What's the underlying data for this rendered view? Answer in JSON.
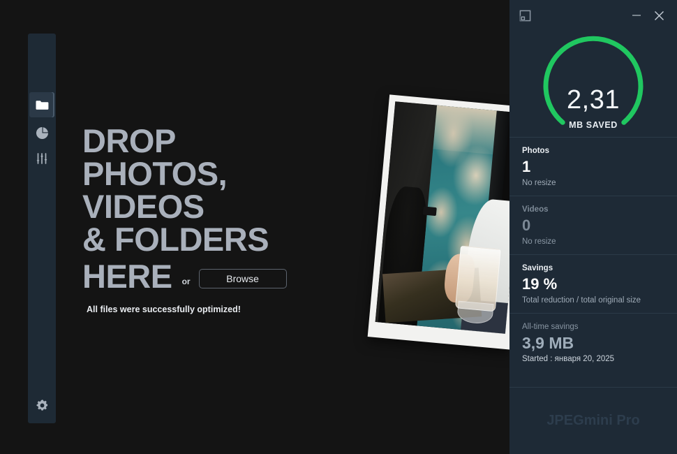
{
  "window": {
    "titlebar": {
      "expand_icon": "expand-panel-icon",
      "minimize_icon": "minimize-icon",
      "close_icon": "close-icon"
    }
  },
  "sidebar": {
    "items": [
      {
        "id": "folder",
        "icon": "folder-icon",
        "active": true
      },
      {
        "id": "stats",
        "icon": "pie-chart-icon",
        "active": false
      },
      {
        "id": "sliders",
        "icon": "sliders-icon",
        "active": false
      }
    ],
    "bottom": {
      "id": "settings",
      "icon": "gear-icon"
    }
  },
  "drop_area": {
    "headline_lines": "DROP\nPHOTOS,\nVIDEOS\n& FOLDERS",
    "headline_last_line": "HERE",
    "or_label": "or",
    "browse_label": "Browse",
    "status_message": "All files were successfully optimized!"
  },
  "photo": {
    "alt": "polaroid-photo-person-holding-glass-of-milk"
  },
  "stats": {
    "gauge": {
      "value": "2,31",
      "label": "MB SAVED",
      "color": "#20c760",
      "track_color": "#1e2a36",
      "percent": 100
    },
    "blocks": [
      {
        "id": "photos",
        "title": "Photos",
        "value": "1",
        "sub": "No resize",
        "dim": false
      },
      {
        "id": "videos",
        "title": "Videos",
        "value": "0",
        "sub": "No resize",
        "dim": true
      },
      {
        "id": "savings",
        "title": "Savings",
        "value": "19 %",
        "sub": "Total reduction / total original size",
        "dim": false
      },
      {
        "id": "all-time",
        "title": "All-time savings",
        "value": "3,9 MB",
        "sub": "Started : января 20, 2025",
        "dim": false
      }
    ],
    "brand": "JPEGmini Pro"
  },
  "colors": {
    "app_background": "#141414",
    "sidebar": "#1e2a35",
    "panel": "#1e2a36",
    "accent_green": "#20c760",
    "headline_gray": "#a9b0bb"
  }
}
